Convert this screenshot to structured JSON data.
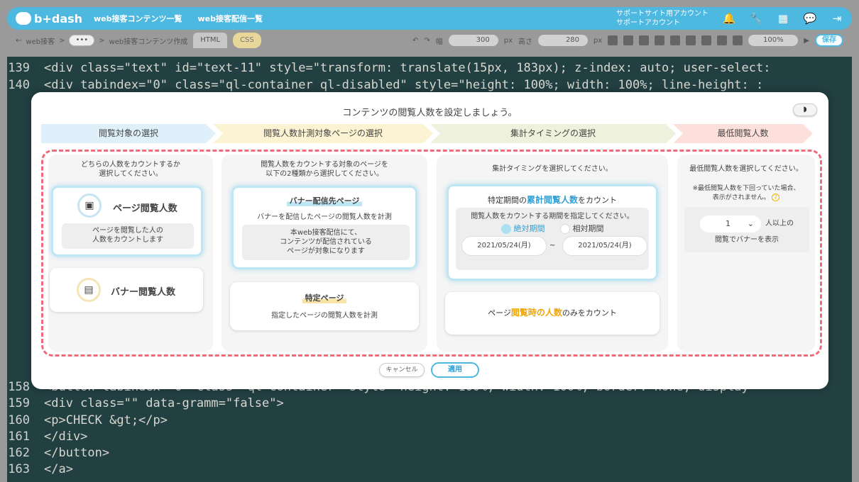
{
  "header": {
    "logo_text": "b+dash",
    "nav": [
      "web接客コンテンツ一覧",
      "web接客配信一覧"
    ],
    "account_line1": "サポートサイト用アカウント",
    "account_line2": "サポートアカウント"
  },
  "toolbar": {
    "crumb1": "web接客",
    "crumb_sep": ">",
    "crumb_dots": "•••",
    "crumb2": "web接客コンテンツ作成",
    "tab_html": "HTML",
    "tab_css": "CSS",
    "width_label": "幅",
    "width_value": "300",
    "px1": "px",
    "height_label": "高さ",
    "height_value": "280",
    "px2": "px",
    "zoom": "100%",
    "save": "保存"
  },
  "editor": {
    "lines": [
      {
        "n": "139",
        "text": "<div class=\"text\" id=\"text-11\" style=\"transform: translate(15px, 183px); z-index: auto; user-select:"
      },
      {
        "n": "140",
        "text": "  <div tabindex=\"0\" class=\"ql-container ql-disabled\" style=\"height: 100%; width: 100%; line-height: :"
      },
      {
        "n": "158",
        "text": "  <button tabindex=\"0\" class=\"ql-container\" style=\"height: 100%; width: 100%; border: none; display"
      },
      {
        "n": "159",
        "text": "    <div class=\"\" data-gramm=\"false\">"
      },
      {
        "n": "160",
        "text": "      <p>CHECK  &gt;</p>"
      },
      {
        "n": "161",
        "text": "    </div>"
      },
      {
        "n": "162",
        "text": "  </button>"
      },
      {
        "n": "163",
        "text": "</a>"
      }
    ]
  },
  "modal": {
    "title": "コンテンツの閲覧人数を設定しましょう。",
    "steps": [
      "閲覧対象の選択",
      "閲覧人数計測対象ページの選択",
      "集計タイミングの選択",
      "最低閲覧人数"
    ],
    "col1": {
      "desc1": "どちらの人数をカウントするか",
      "desc2": "選択してください。",
      "opt1_label": "ページ閲覧人数",
      "opt1_desc1": "ページを閲覧した人の",
      "opt1_desc2": "人数をカウントします",
      "opt2_label": "バナー閲覧人数"
    },
    "col2": {
      "desc1": "閲覧人数をカウントする対象のページを",
      "desc2": "以下の2種類から選択してください。",
      "opt1_title": "バナー配信先ページ",
      "opt1_sub": "バナーを配信したページの閲覧人数を計測",
      "opt1_desc1": "本web接客配信にて、",
      "opt1_desc2": "コンテンツが配信されている",
      "opt1_desc3": "ページが対象になります",
      "opt2_title": "特定ページ",
      "opt2_sub": "指定したページの閲覧人数を計測"
    },
    "col3": {
      "desc": "集計タイミングを選択してください。",
      "opt1_pre": "特定期間の",
      "opt1_em": "累計閲覧人数",
      "opt1_post": "をカウント",
      "period_desc": "閲覧人数をカウントする期間を指定してください。",
      "radio1": "絶対期間",
      "radio2": "相対期間",
      "date_from": "2021/05/24(月)",
      "tilde": "~",
      "date_to": "2021/05/24(月)",
      "opt2_pre": "ページ",
      "opt2_em": "閲覧時の人数",
      "opt2_post": "のみをカウント"
    },
    "col4": {
      "desc": "最低閲覧人数を選択してください。",
      "note1": "※最低閲覧人数を下回っていた場合、",
      "note2": "表示がされません。",
      "help": "?",
      "select_value": "1",
      "suffix": "人以上の",
      "line2": "閲覧でバナーを表示"
    },
    "cancel": "キャンセル",
    "apply": "適用"
  }
}
